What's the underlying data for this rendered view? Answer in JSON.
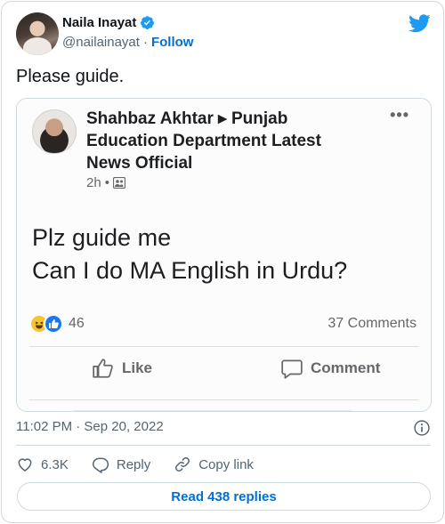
{
  "author": {
    "display_name": "Naila Inayat",
    "handle": "@nailainayat",
    "separator": "·",
    "follow_label": "Follow",
    "verified": true
  },
  "tweet": {
    "text": "Please guide.",
    "timestamp": "11:02 PM · Sep 20, 2022"
  },
  "embedded_post": {
    "author_and_group": "Shahbaz Akhtar ▸ Punjab Education Department Latest News Official",
    "more_label": "•••",
    "time": "2h",
    "time_separator": "•",
    "body_line_1": "Plz guide me",
    "body_line_2": "Can I do MA English in Urdu?",
    "reaction_count": "46",
    "comments": "37 Comments",
    "like_label": "Like",
    "comment_label": "Comment"
  },
  "actions": {
    "likes": "6.3K",
    "reply_label": "Reply",
    "copy_link_label": "Copy link"
  },
  "replies_button": "Read 438 replies",
  "colors": {
    "brand": "#1d9bf0",
    "link": "#006fd6",
    "muted": "#536471",
    "border": "#cfd9de"
  },
  "icons": [
    "verified-icon",
    "twitter-logo-icon",
    "info-icon",
    "heart-icon",
    "reply-icon",
    "link-icon",
    "thumbs-up-icon",
    "comment-icon"
  ]
}
